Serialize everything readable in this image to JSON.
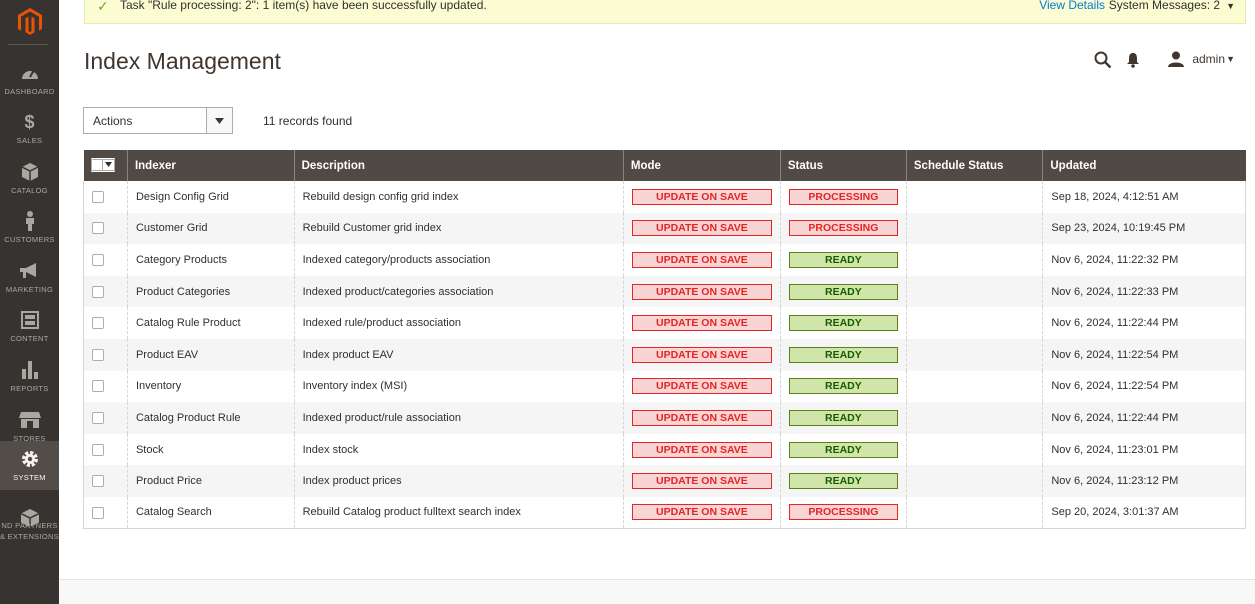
{
  "message": {
    "text": "Task \"Rule processing: 2\": 1 item(s) have been successfully updated.",
    "view_details": "View Details",
    "system_messages": "System Messages: 2"
  },
  "header": {
    "title": "Index Management",
    "user": "admin"
  },
  "sidebar": {
    "items": [
      {
        "label": "DASHBOARD",
        "icon": "dashboard-icon"
      },
      {
        "label": "SALES",
        "icon": "dollar-icon"
      },
      {
        "label": "CATALOG",
        "icon": "box-icon"
      },
      {
        "label": "CUSTOMERS",
        "icon": "person-icon"
      },
      {
        "label": "MARKETING",
        "icon": "megaphone-icon"
      },
      {
        "label": "CONTENT",
        "icon": "layout-icon"
      },
      {
        "label": "REPORTS",
        "icon": "bar-chart-icon"
      },
      {
        "label": "STORES",
        "icon": "storefront-icon"
      },
      {
        "label": "SYSTEM",
        "icon": "gear-icon"
      },
      {
        "label": "ND PARTNERS",
        "label2": "& EXTENSIONS",
        "icon": "cube-icon"
      }
    ]
  },
  "toolbar": {
    "actions_label": "Actions",
    "records_found": "11 records found"
  },
  "table": {
    "columns": [
      "Indexer",
      "Description",
      "Mode",
      "Status",
      "Schedule Status",
      "Updated"
    ],
    "rows": [
      {
        "indexer": "Design Config Grid",
        "description": "Rebuild design config grid index",
        "mode": "UPDATE ON SAVE",
        "status": "PROCESSING",
        "schedule": "",
        "updated": "Sep 18, 2024, 4:12:51 AM"
      },
      {
        "indexer": "Customer Grid",
        "description": "Rebuild Customer grid index",
        "mode": "UPDATE ON SAVE",
        "status": "PROCESSING",
        "schedule": "",
        "updated": "Sep 23, 2024, 10:19:45 PM"
      },
      {
        "indexer": "Category Products",
        "description": "Indexed category/products association",
        "mode": "UPDATE ON SAVE",
        "status": "READY",
        "schedule": "",
        "updated": "Nov 6, 2024, 11:22:32 PM"
      },
      {
        "indexer": "Product Categories",
        "description": "Indexed product/categories association",
        "mode": "UPDATE ON SAVE",
        "status": "READY",
        "schedule": "",
        "updated": "Nov 6, 2024, 11:22:33 PM"
      },
      {
        "indexer": "Catalog Rule Product",
        "description": "Indexed rule/product association",
        "mode": "UPDATE ON SAVE",
        "status": "READY",
        "schedule": "",
        "updated": "Nov 6, 2024, 11:22:44 PM"
      },
      {
        "indexer": "Product EAV",
        "description": "Index product EAV",
        "mode": "UPDATE ON SAVE",
        "status": "READY",
        "schedule": "",
        "updated": "Nov 6, 2024, 11:22:54 PM"
      },
      {
        "indexer": "Inventory",
        "description": "Inventory index (MSI)",
        "mode": "UPDATE ON SAVE",
        "status": "READY",
        "schedule": "",
        "updated": "Nov 6, 2024, 11:22:54 PM"
      },
      {
        "indexer": "Catalog Product Rule",
        "description": "Indexed product/rule association",
        "mode": "UPDATE ON SAVE",
        "status": "READY",
        "schedule": "",
        "updated": "Nov 6, 2024, 11:22:44 PM"
      },
      {
        "indexer": "Stock",
        "description": "Index stock",
        "mode": "UPDATE ON SAVE",
        "status": "READY",
        "schedule": "",
        "updated": "Nov 6, 2024, 11:23:01 PM"
      },
      {
        "indexer": "Product Price",
        "description": "Index product prices",
        "mode": "UPDATE ON SAVE",
        "status": "READY",
        "schedule": "",
        "updated": "Nov 6, 2024, 11:23:12 PM"
      },
      {
        "indexer": "Catalog Search",
        "description": "Rebuild Catalog product fulltext search index",
        "mode": "UPDATE ON SAVE",
        "status": "PROCESSING",
        "schedule": "",
        "updated": "Sep 20, 2024, 3:01:37 AM"
      }
    ]
  },
  "colors": {
    "sidebar_bg": "#373330",
    "header_row_bg": "#514943",
    "brand_orange": "#eb5202",
    "ready_bg": "#d0e5a9",
    "processing_bg": "#f9d4d4"
  }
}
